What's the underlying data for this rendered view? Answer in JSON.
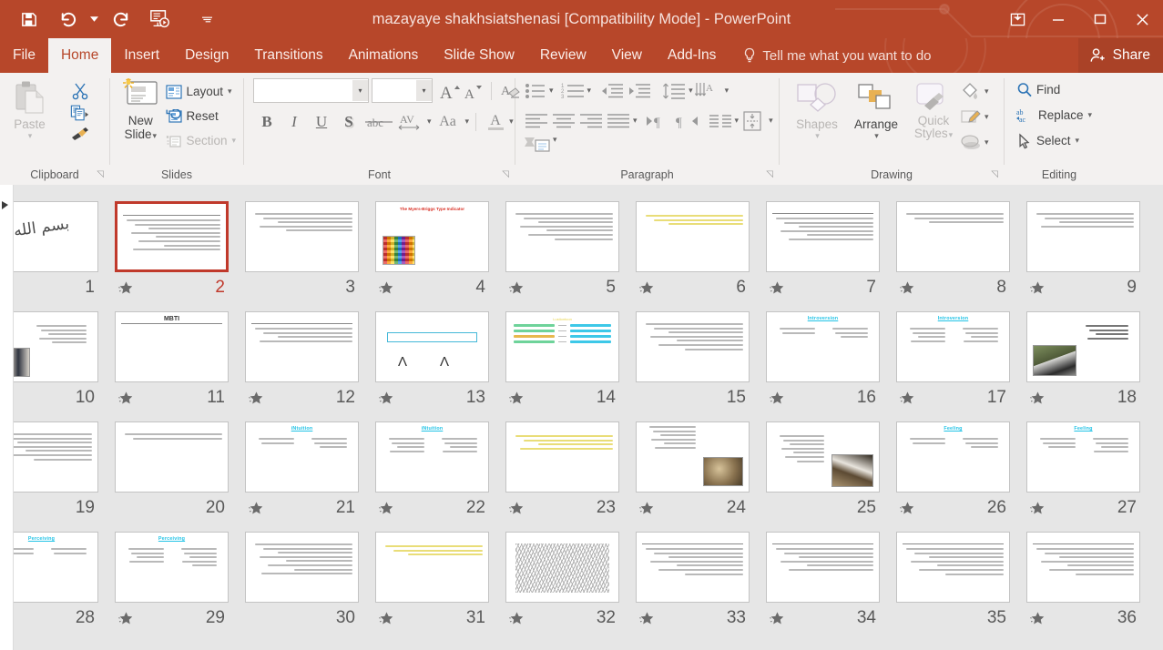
{
  "titlebar": {
    "document_title": "mazayaye shakhsiatshenasi [Compatibility Mode] - PowerPoint",
    "quick_access": [
      {
        "name": "save-button",
        "label": "Save"
      },
      {
        "name": "undo-button",
        "label": "Undo"
      },
      {
        "name": "redo-button",
        "label": "Redo"
      },
      {
        "name": "start-from-beginning-button",
        "label": "Start From Beginning"
      },
      {
        "name": "customize-quick-access-toolbar",
        "label": "Customize Quick Access Toolbar"
      }
    ],
    "window_controls": [
      {
        "name": "ribbon-display-options",
        "label": "Ribbon Display Options"
      },
      {
        "name": "minimize-button",
        "label": "Minimize"
      },
      {
        "name": "restore-button",
        "label": "Restore Down"
      },
      {
        "name": "close-button",
        "label": "Close"
      }
    ]
  },
  "tabs": [
    {
      "label": "File",
      "active": false
    },
    {
      "label": "Home",
      "active": true
    },
    {
      "label": "Insert",
      "active": false
    },
    {
      "label": "Design",
      "active": false
    },
    {
      "label": "Transitions",
      "active": false
    },
    {
      "label": "Animations",
      "active": false
    },
    {
      "label": "Slide Show",
      "active": false
    },
    {
      "label": "Review",
      "active": false
    },
    {
      "label": "View",
      "active": false
    },
    {
      "label": "Add-Ins",
      "active": false
    }
  ],
  "tellme": {
    "label": "Tell me what you want to do"
  },
  "share": {
    "label": "Share"
  },
  "ribbon": {
    "clipboard": {
      "group_label": "Clipboard",
      "paste_label": "Paste",
      "cut_label": "Cut",
      "copy_label": "Copy",
      "format_painter_label": "Format Painter",
      "dialog_launcher": "✐"
    },
    "slides": {
      "group_label": "Slides",
      "new_slide_label": "New\nSlide",
      "new_slide_line1": "New",
      "new_slide_line2": "Slide",
      "layout_label": "Layout",
      "reset_label": "Reset",
      "section_label": "Section"
    },
    "font": {
      "group_label": "Font",
      "font_name_value": "",
      "font_size_value": "",
      "increase_font_label": "Increase Font Size",
      "decrease_font_label": "Decrease Font Size",
      "clear_formatting_label": "Clear All Formatting",
      "bold_label": "B",
      "italic_label": "I",
      "underline_label": "U",
      "shadow_label": "S",
      "strikethrough_label": "abc",
      "spacing_label": "AV",
      "change_case_label": "Aa",
      "font_color_label": "A"
    },
    "paragraph": {
      "group_label": "Paragraph",
      "bullets_label": "Bullets",
      "numbering_label": "Numbering",
      "decrease_indent_label": "Decrease List Level",
      "increase_indent_label": "Increase List Level",
      "line_spacing_label": "Line Spacing",
      "align_left_label": "Align Left",
      "center_label": "Center",
      "align_right_label": "Align Right",
      "justify_label": "Justify",
      "ltr_label": "Left-to-Right",
      "rtl_label": "Right-to-Left",
      "columns_label": "Columns",
      "text_direction_label": "Text Direction",
      "align_text_label": "Align Text",
      "smartart_label": "Convert to SmartArt"
    },
    "drawing": {
      "group_label": "Drawing",
      "shapes_label": "Shapes",
      "arrange_label": "Arrange",
      "quick_styles_label": "Quick\nStyles",
      "quick_styles_line1": "Quick",
      "quick_styles_line2": "Styles",
      "shape_fill_label": "Shape Fill",
      "shape_outline_label": "Shape Outline",
      "shape_effects_label": "Shape Effects"
    },
    "editing": {
      "group_label": "Editing",
      "find_label": "Find",
      "replace_label": "Replace",
      "select_label": "Select"
    }
  },
  "colors": {
    "accent": "#b7472a",
    "selection": "#c0392b",
    "ribbon_bg": "#f3f1f0",
    "workspace_bg": "#e6e6e6",
    "thumb_bg": "#ffffff"
  },
  "slide_sorter": {
    "selected_slide": 2,
    "rows": [
      [
        {
          "number": 9,
          "star": true,
          "kind": "text",
          "title": "",
          "lines": 4
        },
        {
          "number": 8,
          "star": true,
          "kind": "text",
          "title": "",
          "lines": 3
        },
        {
          "number": 7,
          "star": true,
          "kind": "text-title",
          "title": "",
          "lines": 6
        },
        {
          "number": 6,
          "star": true,
          "kind": "yellow-text",
          "title": "",
          "lines": 3
        },
        {
          "number": 5,
          "star": true,
          "kind": "two-col",
          "title": "",
          "lines": 7
        },
        {
          "number": 4,
          "star": true,
          "kind": "mbti-cover",
          "title": "The Myers-Briggs Type Indicator",
          "lines": 0
        },
        {
          "number": 3,
          "star": false,
          "kind": "text",
          "title": "",
          "lines": 5
        },
        {
          "number": 2,
          "star": true,
          "kind": "text-title",
          "title": "",
          "lines": 8,
          "selected": true
        },
        {
          "number": 1,
          "star": true,
          "kind": "signature",
          "title": "",
          "lines": 0
        }
      ],
      [
        {
          "number": 18,
          "star": true,
          "kind": "photo-cat",
          "title": "",
          "lines": 4
        },
        {
          "number": 17,
          "star": true,
          "kind": "heading-two-col",
          "title": "Introversion",
          "lines": 8
        },
        {
          "number": 16,
          "star": true,
          "kind": "heading-two-col",
          "title": "Introversion",
          "lines": 5
        },
        {
          "number": 15,
          "star": false,
          "kind": "text",
          "title": "",
          "lines": 7
        },
        {
          "number": 14,
          "star": true,
          "kind": "pairs",
          "title": "Lustiontoon",
          "lines": 4
        },
        {
          "number": 13,
          "star": true,
          "kind": "diagram",
          "title": "",
          "lines": 0
        },
        {
          "number": 12,
          "star": true,
          "kind": "text-title",
          "title": "",
          "lines": 4
        },
        {
          "number": 11,
          "star": true,
          "kind": "mbti-heading",
          "title": "MBTI",
          "lines": 0
        },
        {
          "number": 10,
          "star": true,
          "kind": "photo-people",
          "title": "",
          "lines": 5
        }
      ],
      [
        {
          "number": 27,
          "star": true,
          "kind": "heading-two-col",
          "title": "Feeling",
          "lines": 7
        },
        {
          "number": 26,
          "star": true,
          "kind": "heading-two-col",
          "title": "Feeling",
          "lines": 5
        },
        {
          "number": 25,
          "star": false,
          "kind": "photo-cat2",
          "title": "",
          "lines": 7
        },
        {
          "number": 24,
          "star": true,
          "kind": "photo-dog",
          "title": "",
          "lines": 6
        },
        {
          "number": 23,
          "star": true,
          "kind": "yellow-text",
          "title": "",
          "lines": 4
        },
        {
          "number": 22,
          "star": true,
          "kind": "heading-two-col",
          "title": "iNtuition",
          "lines": 8
        },
        {
          "number": 21,
          "star": true,
          "kind": "heading-two-col",
          "title": "iNtuition",
          "lines": 5
        },
        {
          "number": 20,
          "star": false,
          "kind": "text",
          "title": "",
          "lines": 2
        },
        {
          "number": 19,
          "star": true,
          "kind": "text",
          "title": "",
          "lines": 7
        }
      ],
      [
        {
          "number": 36,
          "star": true,
          "kind": "text-title",
          "title": "",
          "lines": 7
        },
        {
          "number": 35,
          "star": false,
          "kind": "text-title",
          "title": "",
          "lines": 7
        },
        {
          "number": 34,
          "star": true,
          "kind": "text-title",
          "title": "",
          "lines": 6
        },
        {
          "number": 33,
          "star": true,
          "kind": "text-title",
          "title": "",
          "lines": 7
        },
        {
          "number": 32,
          "star": true,
          "kind": "scribble",
          "title": "",
          "lines": 0
        },
        {
          "number": 31,
          "star": true,
          "kind": "yellow-text",
          "title": "",
          "lines": 0
        },
        {
          "number": 30,
          "star": false,
          "kind": "text",
          "title": "",
          "lines": 8
        },
        {
          "number": 29,
          "star": true,
          "kind": "heading-two-col",
          "title": "Perceiving",
          "lines": 9
        },
        {
          "number": 28,
          "star": true,
          "kind": "heading-two-col",
          "title": "Perceiving",
          "lines": 4
        }
      ]
    ]
  }
}
